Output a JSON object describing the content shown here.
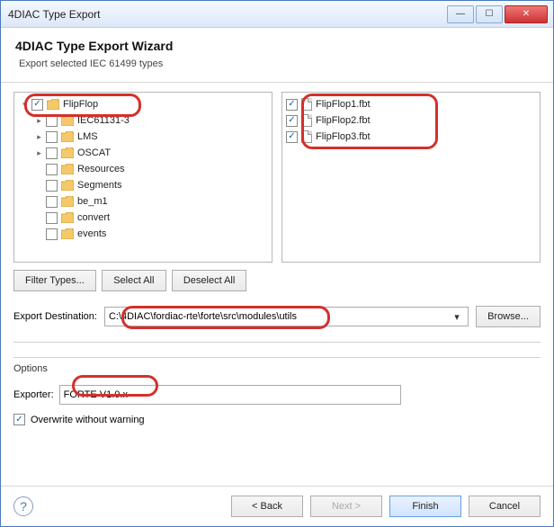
{
  "window": {
    "title": "4DIAC Type Export"
  },
  "header": {
    "title": "4DIAC Type Export Wizard",
    "subtitle": "Export selected IEC 61499 types"
  },
  "tree": [
    {
      "label": "FlipFlop",
      "depth": 0,
      "exp": "open",
      "checked": true
    },
    {
      "label": "IEC61131-3",
      "depth": 1,
      "exp": "closed",
      "checked": false
    },
    {
      "label": "LMS",
      "depth": 1,
      "exp": "closed",
      "checked": false
    },
    {
      "label": "OSCAT",
      "depth": 1,
      "exp": "closed",
      "checked": false
    },
    {
      "label": "Resources",
      "depth": 1,
      "exp": "none",
      "checked": false
    },
    {
      "label": "Segments",
      "depth": 1,
      "exp": "none",
      "checked": false
    },
    {
      "label": "be_m1",
      "depth": 1,
      "exp": "none",
      "checked": false
    },
    {
      "label": "convert",
      "depth": 1,
      "exp": "none",
      "checked": false
    },
    {
      "label": "events",
      "depth": 1,
      "exp": "none",
      "checked": false
    }
  ],
  "list": [
    {
      "label": "FlipFlop1.fbt",
      "checked": true
    },
    {
      "label": "FlipFlop2.fbt",
      "checked": true
    },
    {
      "label": "FlipFlop3.fbt",
      "checked": true
    }
  ],
  "buttons": {
    "filter": "Filter Types...",
    "selectAll": "Select All",
    "deselectAll": "Deselect All",
    "browse": "Browse..."
  },
  "dest": {
    "label": "Export Destination:",
    "value": "C:\\4DIAC\\fordiac-rte\\forte\\src\\modules\\utils"
  },
  "options": {
    "group": "Options",
    "exporterLabel": "Exporter:",
    "exporterValue": "FORTE V1.0.x",
    "overwriteLabel": "Overwrite without warning",
    "overwriteChecked": true
  },
  "footer": {
    "back": "< Back",
    "next": "Next >",
    "finish": "Finish",
    "cancel": "Cancel"
  }
}
